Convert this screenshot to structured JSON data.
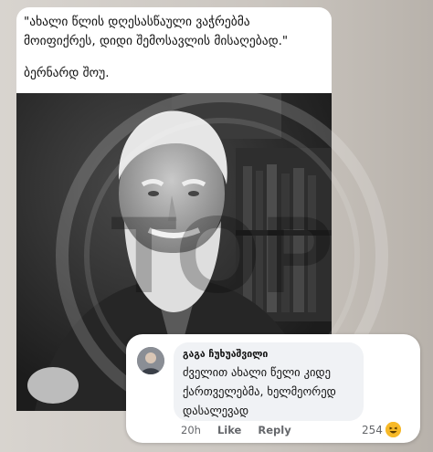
{
  "post": {
    "quote_line1": "\"ახალი წლის დღესასწაული ვაჭრებმა",
    "quote_line2": "მოიფიქრეს, დიდი შემოსავლის მისაღებად.\"",
    "author": "ბერნარდ შოუ."
  },
  "watermark": {
    "letters": "TOP"
  },
  "comment": {
    "name": "გაგა ჩუხუაშვილი",
    "line1": "ძველით ახალი წელი კიდე",
    "line2": "ქართველებმა, ხელმეორედ",
    "line3": "დასალევად",
    "time": "20h",
    "like_label": "Like",
    "reply_label": "Reply",
    "reaction_count": "254",
    "reaction_icon": "haha-emoji-icon"
  },
  "colors": {
    "background": "#cfcac4",
    "card": "#ffffff",
    "bubble": "#f0f2f5",
    "reaction": "#f7b928",
    "meta_text": "#65676b"
  }
}
